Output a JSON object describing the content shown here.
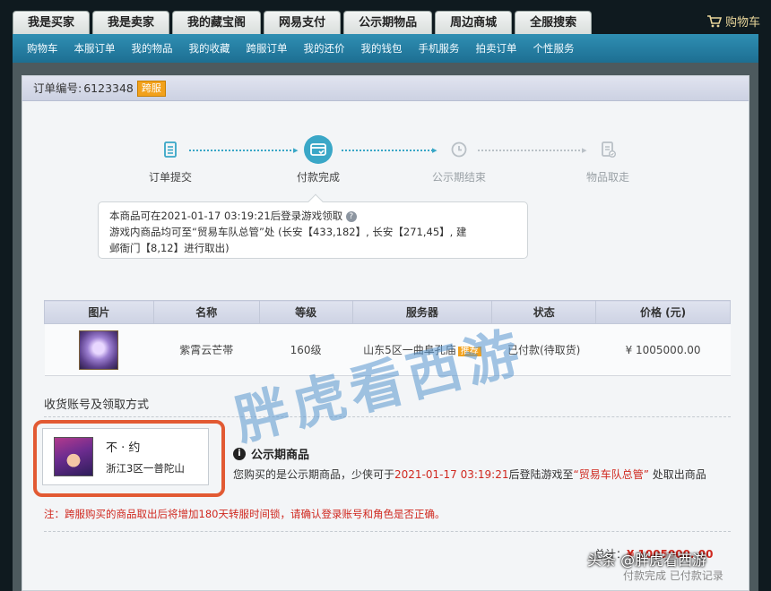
{
  "top_tabs": [
    "我是买家",
    "我是卖家",
    "我的藏宝阁",
    "网易支付",
    "公示期物品",
    "周边商城",
    "全服搜索"
  ],
  "cart_label": "购物车",
  "nav": [
    "购物车",
    "本服订单",
    "我的物品",
    "我的收藏",
    "跨服订单",
    "我的还价",
    "我的钱包",
    "手机服务",
    "拍卖订单",
    "个性服务"
  ],
  "order": {
    "label": "订单编号:",
    "number": "6123348",
    "badge": "跨服"
  },
  "steps": [
    {
      "label": "订单提交",
      "state": "done",
      "icon": "form-icon"
    },
    {
      "label": "付款完成",
      "state": "active",
      "icon": "payment-icon"
    },
    {
      "label": "公示期结束",
      "state": "pending",
      "icon": "clock-icon"
    },
    {
      "label": "物品取走",
      "state": "pending",
      "icon": "pickup-icon"
    }
  ],
  "tip": {
    "line1": "本商品可在2021-01-17 03:19:21后登录游戏领取",
    "line2": "游戏内商品均可至“贸易车队总管”处 (长安【433,182】, 长安【271,45】, 建",
    "line3": "邺衙门【8,12】进行取出)"
  },
  "table": {
    "headers": [
      "图片",
      "名称",
      "等级",
      "服务器",
      "状态",
      "价格 (元)"
    ],
    "row": {
      "name": "紫霄云芒帯",
      "level": "160级",
      "server": "山东5区一曲阜孔庙",
      "server_badge": "推荐",
      "status": "已付款(待取货)",
      "price": "¥ 1005000.00"
    }
  },
  "account": {
    "section_title": "收货账号及领取方式",
    "name": "不 · 约",
    "server": "浙江3区一普陀山"
  },
  "public_notice": {
    "title": "公示期商品",
    "prefix": "您购买的是公示期商品，少侠可于",
    "date": "2021-01-17 03:19:21",
    "middle": "后登陆游戏至",
    "npc": "“贸易车队总管”",
    "suffix": " 处取出商品"
  },
  "warning": "注：跨服购买的商品取出后将增加180天转服时间锁，请确认登录账号和角色是否正确。",
  "total": {
    "label": "总计：",
    "amount": "¥ 1005000. 00"
  },
  "status_line": "付款完成 已付款记录",
  "watermark": "胖虎看西游",
  "corner_watermark": "头条 @胖虎看西游",
  "colors": {
    "accent": "#38a6c6",
    "badge": "#f2a11c",
    "red": "#d0281f",
    "highlight": "#e25a33"
  }
}
